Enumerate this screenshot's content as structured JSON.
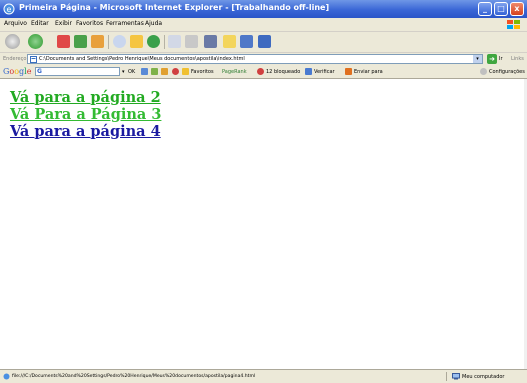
{
  "window": {
    "title": "Primeira Página - Microsoft Internet Explorer - [Trabalhando off-line]",
    "buttons": [
      "_",
      "□",
      "x"
    ]
  },
  "menu": [
    "Arquivo",
    "Editar",
    "Exibir",
    "Favoritos",
    "Ferramentas",
    "Ajuda"
  ],
  "address": {
    "label": "Endereço",
    "value": "C:\\Documents and Settings\\Pedro Henrique\\Meus documentos\\apostila\\index.html",
    "go_label": "Ir",
    "links_label": "Links"
  },
  "google_toolbar": {
    "logo": "Google",
    "search_prefix": "G",
    "ok_label": "OK",
    "favorites_label": "Favoritos",
    "pagerank_label": "PageRank",
    "blocked_label": "12 bloqueado",
    "check_label": "Verificar",
    "send_label": "Enviar para",
    "settings_label": "Configurações"
  },
  "links": [
    {
      "text": "Vá para a página 2",
      "color": "#22aa22"
    },
    {
      "text": "Vá Para a Página 3",
      "color": "#33bb33"
    },
    {
      "text": "Vá para a página 4",
      "color": "#1a1aa0"
    }
  ],
  "status": {
    "text": "file:///C:/Documents%20and%20Settings/Pedro%20Henrique/Meus%20documentos/apostila/pagina4.html",
    "zone": "Meu computador"
  }
}
